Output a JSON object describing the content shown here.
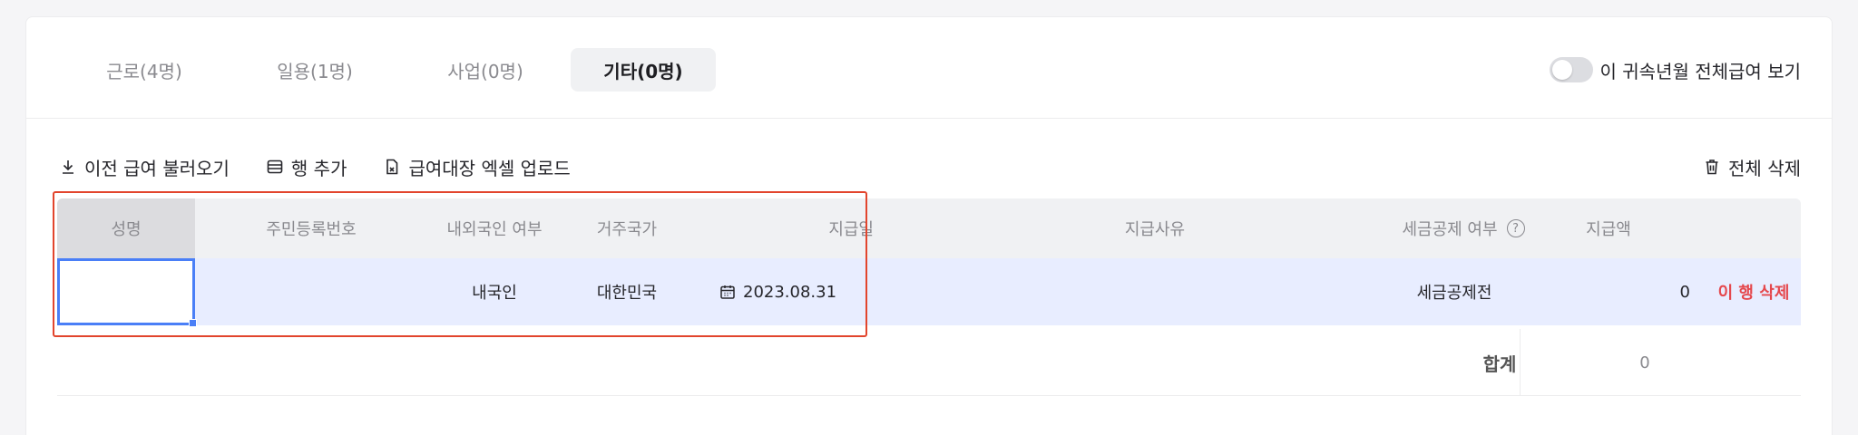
{
  "tabs": [
    {
      "label": "근로(4명)",
      "active": false
    },
    {
      "label": "일용(1명)",
      "active": false
    },
    {
      "label": "사업(0명)",
      "active": false
    },
    {
      "label": "기타(0명)",
      "active": true
    }
  ],
  "toggle": {
    "label": "이 귀속년월 전체급여 보기",
    "on": false
  },
  "toolbar": {
    "load_prev": "이전 급여 불러오기",
    "add_row": "행 추가",
    "excel_upload": "급여대장 엑셀 업로드",
    "delete_all": "전체 삭제"
  },
  "table": {
    "headers": {
      "name": "성명",
      "rrn": "주민등록번호",
      "nationality": "내외국인 여부",
      "country": "거주국가",
      "pay_date": "지급일",
      "reason": "지급사유",
      "tax": "세금공제 여부",
      "amount": "지급액"
    },
    "row": {
      "name": "",
      "rrn": "",
      "nationality": "내국인",
      "country": "대한민국",
      "pay_date": "2023.08.31",
      "reason": "",
      "tax": "세금공제전",
      "amount": "0",
      "delete": "이 행 삭제"
    },
    "total": {
      "label": "합계",
      "value": "0"
    }
  },
  "colors": {
    "accent": "#4a7ff7",
    "delete_red": "#e5484d",
    "highlight_box": "#e2452d",
    "row_bg": "#e8edff"
  }
}
